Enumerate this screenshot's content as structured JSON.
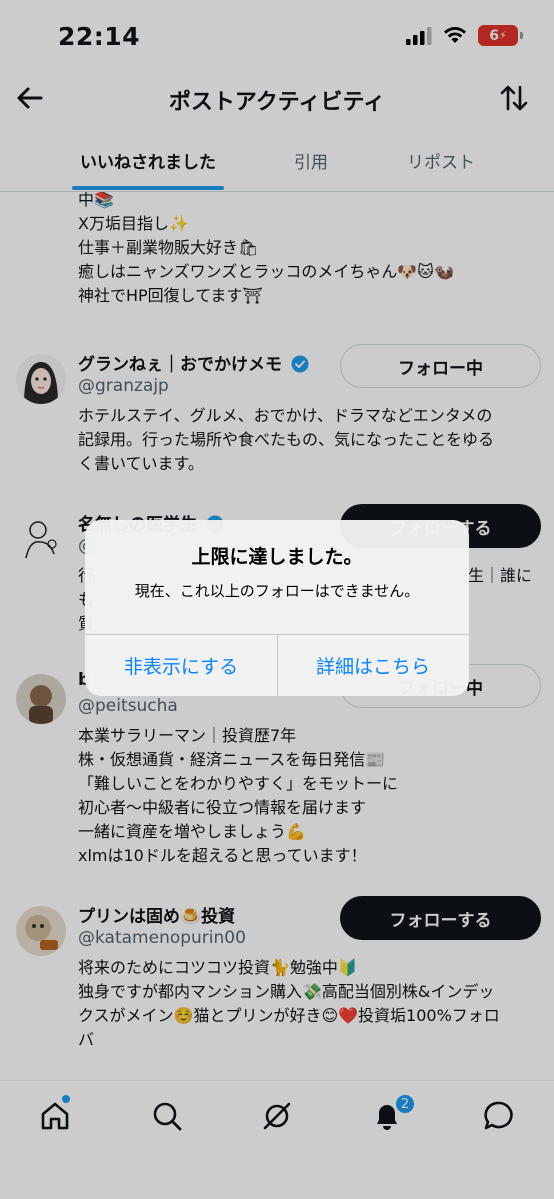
{
  "status_bar": {
    "time": "22:14",
    "battery": "6"
  },
  "header": {
    "title": "ポストアクティビティ",
    "back_icon": "back-arrow-icon",
    "sort_icon": "sort-arrows-icon"
  },
  "tabs": [
    {
      "label": "いいねされました",
      "active": true
    },
    {
      "label": "引用",
      "active": false
    },
    {
      "label": "リポスト",
      "active": false
    }
  ],
  "previous_bio": [
    "中📚",
    "X万垢目指し✨",
    "仕事＋副業物販大好き🛍",
    "癒しはニャンズワンズとラッコのメイちゃん🐶🐱🦦",
    "神社でHP回復してます⛩"
  ],
  "users": [
    {
      "name": "グランねぇ｜おでかけメモ",
      "handle": "@granzajp",
      "verified": true,
      "button": "フォロー中",
      "bio": [
        "ホテルステイ、グルメ、おでかけ、ドラマなどエンタメの",
        "記録用。行った場所や食べたもの、気になったことをゆる",
        "く書いています。"
      ]
    },
    {
      "name": "名無しの医学生",
      "handle": "@",
      "verified": true,
      "button": "フォローする",
      "bio": [
        "行",
        "も",
        "質"
      ],
      "bio_right": [
        "生｜誰に"
      ]
    },
    {
      "name": "b",
      "handle": "@peitsucha",
      "verified": false,
      "button": "フォロー中",
      "bio": [
        "本業サラリーマン｜投資歴7年",
        "株・仮想通貨・経済ニュースを毎日発信📰",
        "「難しいことをわかりやすく」をモットーに",
        "初心者〜中級者に役立つ情報を届けます",
        "一緒に資産を増やしましょう💪",
        "xlmは10ドルを超えると思っています！"
      ]
    },
    {
      "name": "プリンは固め🍮投資",
      "handle": "@katamenopurin00",
      "verified": false,
      "button": "フォローする",
      "bio": [
        "将来のためにコツコツ投資🐈勉強中🔰",
        "独身ですが都内マンション購入💸高配当個別株&インデッ",
        "クスがメイン☺️猫とプリンが好き😊❤️投資垢100%フォロ",
        "バ"
      ]
    }
  ],
  "bottom_nav": {
    "items": [
      "home-icon",
      "search-icon",
      "grok-icon",
      "notifications-icon",
      "messages-icon"
    ],
    "notification_badge": "2"
  },
  "dialog": {
    "title": "上限に達しました。",
    "message": "現在、これ以上のフォローはできません。",
    "hide_button": "非表示にする",
    "details_button": "詳細はこちら"
  },
  "colors": {
    "accent": "#1d9bf0",
    "alert_link": "#0a84ff",
    "text": "#0f1419",
    "secondary": "#536471"
  }
}
